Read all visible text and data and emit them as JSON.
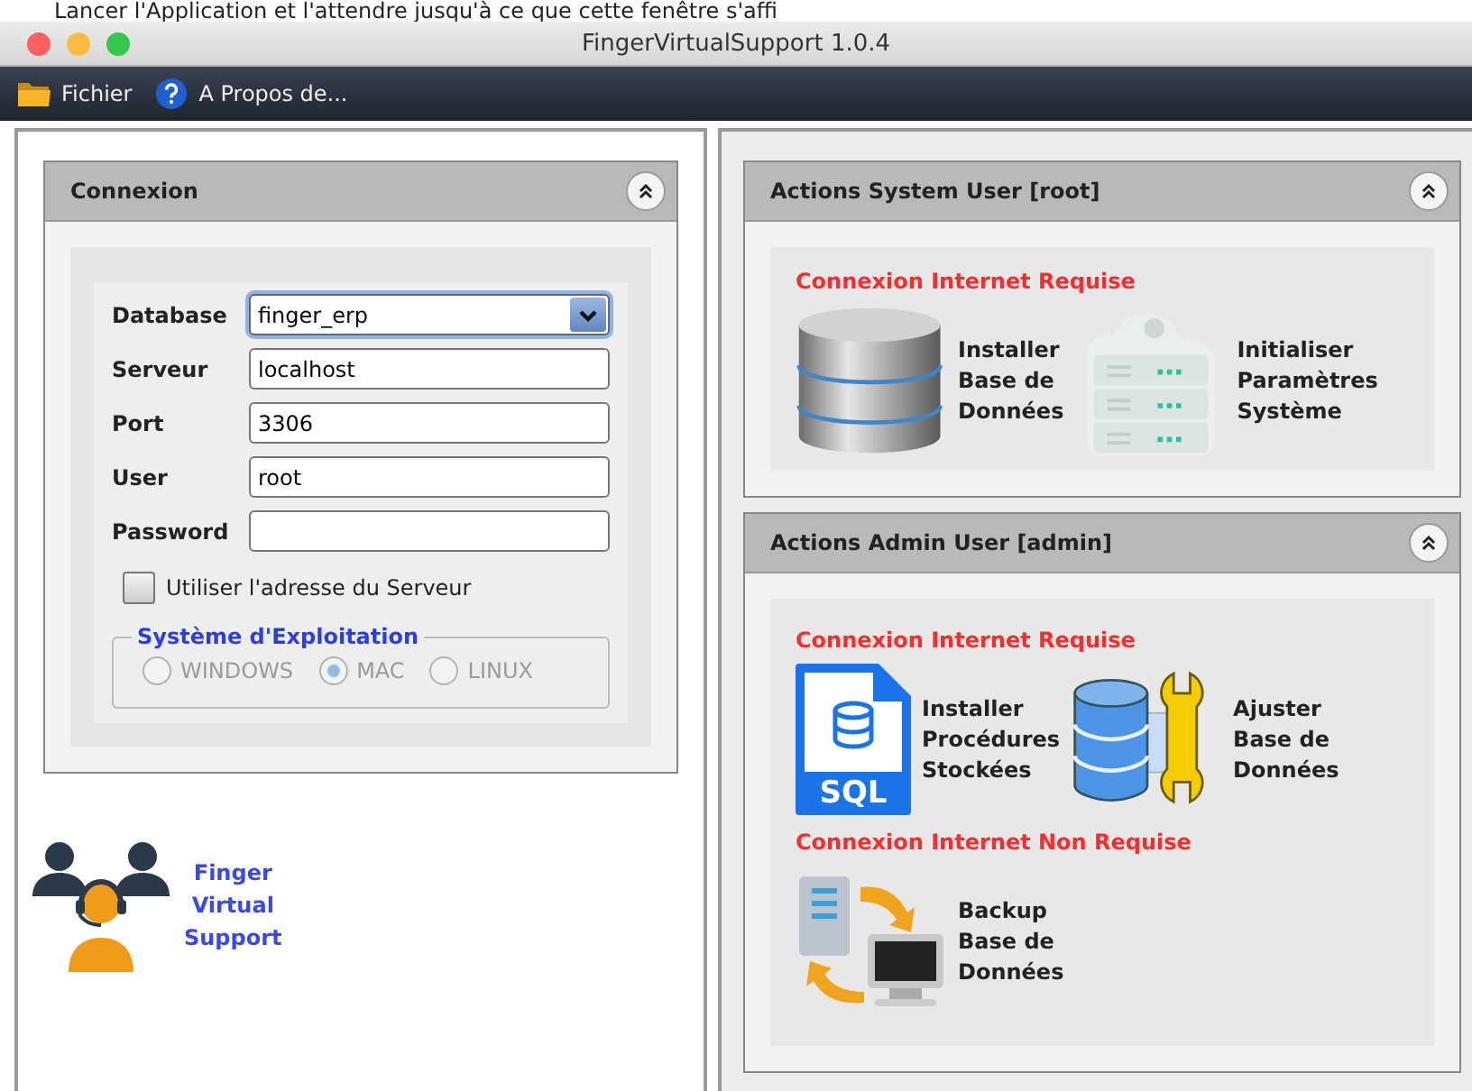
{
  "caption": "Lancer l'Application et l'attendre jusqu'à ce que cette fenêtre s'affi",
  "window": {
    "title": "FingerVirtualSupport 1.0.4"
  },
  "menu": [
    {
      "label": "Fichier",
      "kind": "folder"
    },
    {
      "label": "A Propos de...",
      "kind": "help"
    }
  ],
  "connexion": {
    "title": "Connexion",
    "fields": [
      {
        "label": "Database",
        "kind": "combo",
        "value": "finger_erp",
        "focused": true
      },
      {
        "label": "Serveur",
        "kind": "text",
        "value": "localhost",
        "focused": false
      },
      {
        "label": "Port",
        "kind": "text",
        "value": "3306",
        "focused": false
      },
      {
        "label": "User",
        "kind": "text",
        "value": "root",
        "focused": false
      },
      {
        "label": "Password",
        "kind": "password",
        "focused": false
      }
    ],
    "checkbox": {
      "label": "Utiliser l'adresse du Serveur",
      "checked": false
    },
    "os_group": {
      "title": "Système d'Exploitation",
      "disabled": true,
      "options": [
        {
          "label": "WINDOWS",
          "selected": false
        },
        {
          "label": "MAC",
          "selected": true
        },
        {
          "label": "LINUX",
          "selected": false
        }
      ]
    }
  },
  "logo": {
    "text": "Finger\nVirtual\nSupport"
  },
  "panels": [
    {
      "title": "Actions System User [root]",
      "sections": [
        {
          "notice": "Connexion Internet Requise",
          "actions": [
            {
              "kind": "database",
              "label": "Installer\nBase de\nDonnées"
            },
            {
              "kind": "server",
              "label": "Initialiser\nParamètres\nSystème"
            }
          ]
        }
      ]
    },
    {
      "title": "Actions Admin User [admin]",
      "sections": [
        {
          "notice": "Connexion Internet Requise",
          "actions": [
            {
              "kind": "sql",
              "file_type": "SQL",
              "label": "Installer\nProcédures\nStockées"
            },
            {
              "kind": "wrench",
              "label": "Ajuster\nBase de\nDonnées"
            }
          ]
        },
        {
          "notice": "Connexion Internet Non Requise",
          "actions": [
            {
              "kind": "backup",
              "label": "Backup\nBase de\nDonnées"
            }
          ]
        }
      ]
    }
  ]
}
